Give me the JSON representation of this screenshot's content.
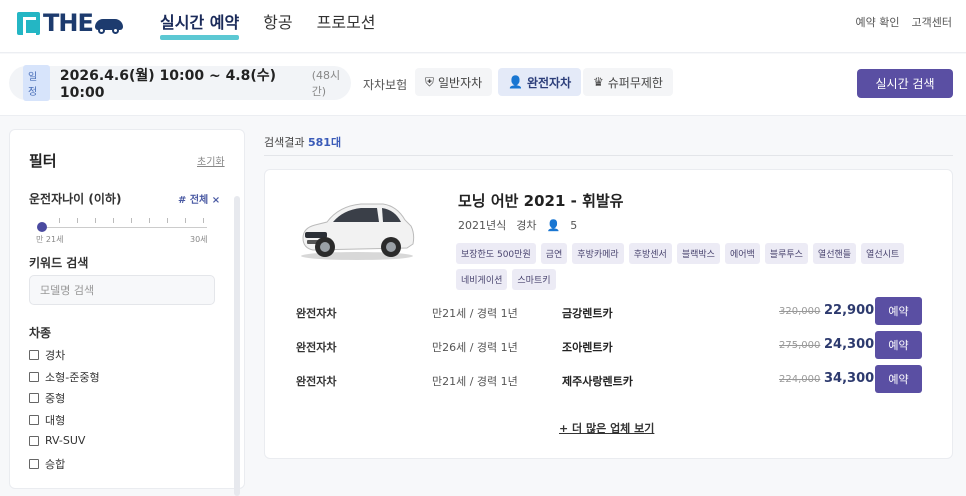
{
  "header": {
    "logo_text": "THE",
    "nav": [
      "실시간 예약",
      "항공",
      "프로모션"
    ],
    "links": [
      "예약 확인",
      "고객센터"
    ]
  },
  "searchbar": {
    "badge": "일정",
    "dates": "2026.4.6(월) 10:00 ~ 4.8(수) 10:00",
    "duration": "(48시간)",
    "insurance_label": "자차보험",
    "insurance_options": [
      "일반자차",
      "완전자차",
      "슈퍼무제한"
    ],
    "insurance_selected": "완전자차",
    "search_button": "실시간 검색"
  },
  "filter": {
    "title": "필터",
    "reset": "초기화",
    "age_label": "운전자나이 (이하)",
    "age_all": "# 전체 ×",
    "age_min": "만 21세",
    "age_max": "30세",
    "keyword_label": "키워드 검색",
    "keyword_placeholder": "모델명 검색",
    "type_label": "차종",
    "types": [
      "경차",
      "소형-준중형",
      "중형",
      "대형",
      "RV-SUV",
      "승합"
    ]
  },
  "results": {
    "prefix": "검색결과 ",
    "count": "581대"
  },
  "car": {
    "name": "모닝 어반 2021 - 휘발유",
    "year": "2021년식",
    "class": "경차",
    "seats": "5",
    "tags": [
      "보장한도 500만원",
      "금연",
      "후방카메라",
      "후방센서",
      "블랙박스",
      "에어백",
      "블루투스",
      "열선핸들",
      "열선시트",
      "네비게이션",
      "스마트키"
    ],
    "offers": [
      {
        "insurance": "완전자차",
        "requirement": "만21세 / 경력 1년",
        "company": "금강렌트카",
        "original": "320,000",
        "price": "22,900",
        "button": "예약"
      },
      {
        "insurance": "완전자차",
        "requirement": "만26세 / 경력 1년",
        "company": "조아렌트카",
        "original": "275,000",
        "price": "24,300",
        "button": "예약"
      },
      {
        "insurance": "완전자차",
        "requirement": "만21세 / 경력 1년",
        "company": "제주사랑렌트카",
        "original": "224,000",
        "price": "34,300",
        "button": "예약"
      }
    ],
    "more": "+ 더 많은 업체 보기"
  },
  "colors": {
    "accent": "#5a4fa3",
    "teal": "#24b6c4",
    "navy": "#1d3b6e"
  }
}
